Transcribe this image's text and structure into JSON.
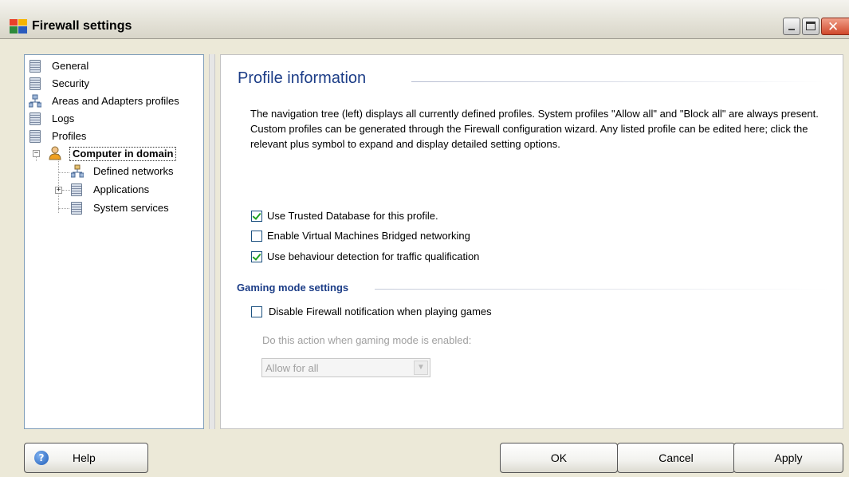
{
  "window": {
    "title": "Firewall settings",
    "controls": {
      "minimize": "minimize-icon",
      "maximize": "maximize-icon",
      "close": "close-icon"
    }
  },
  "tree": {
    "items": [
      {
        "label": "General",
        "icon": "document-list-icon"
      },
      {
        "label": "Security",
        "icon": "document-list-icon"
      },
      {
        "label": "Areas and Adapters profiles",
        "icon": "network-icon"
      },
      {
        "label": "Logs",
        "icon": "document-list-icon"
      },
      {
        "label": "Profiles",
        "icon": "document-list-icon"
      },
      {
        "label": "Computer in domain",
        "icon": "user-icon",
        "selected": true,
        "expanded": true
      },
      {
        "label": "Defined networks",
        "icon": "network-icon"
      },
      {
        "label": "Applications",
        "icon": "document-list-icon",
        "expandable": true
      },
      {
        "label": "System services",
        "icon": "document-list-icon"
      }
    ]
  },
  "content": {
    "title": "Profile information",
    "description": "The navigation tree (left) displays all currently defined profiles. System profiles \"Allow all\" and \"Block all\" are always present. Custom profiles can be generated through the Firewall configuration wizard. Any listed profile can be edited here; click the relevant plus symbol to expand and display detailed setting options.",
    "options": [
      {
        "label": "Use Trusted Database for this profile.",
        "checked": true
      },
      {
        "label": "Enable Virtual Machines Bridged networking",
        "checked": false
      },
      {
        "label": "Use behaviour detection for traffic qualification",
        "checked": true
      }
    ],
    "gaming": {
      "title": "Gaming mode settings",
      "disable_notification": {
        "label": "Disable Firewall notification when playing games",
        "checked": false
      },
      "action_label": "Do this action when gaming mode is enabled:",
      "action_value": "Allow for all"
    }
  },
  "buttons": {
    "help": "Help",
    "ok": "OK",
    "cancel": "Cancel",
    "apply": "Apply"
  },
  "colors": {
    "heading": "#1c3d87",
    "checkmark": "#21a121",
    "disabled": "#a0a0a0"
  }
}
